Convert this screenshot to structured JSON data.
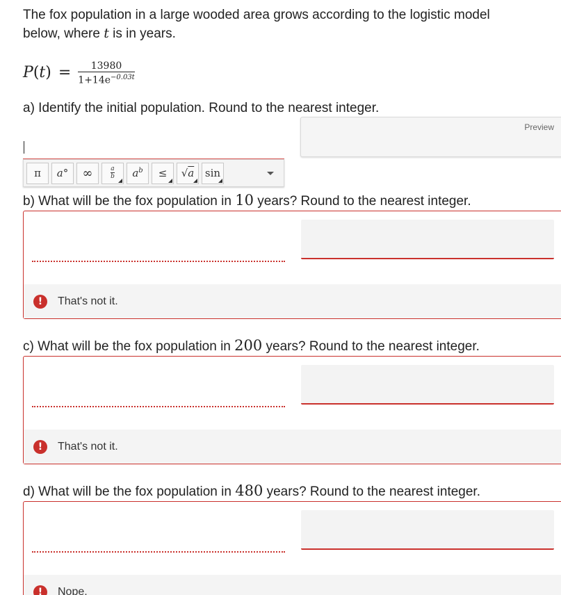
{
  "intro": {
    "line1": "The fox population in a large wooded area grows according to the logistic model",
    "line2_before": "below, where ",
    "line2_var": "t",
    "line2_after": " is in years."
  },
  "formula": {
    "lhs_func": "P",
    "lhs_open": "(",
    "lhs_var": "t",
    "lhs_close": ")",
    "equals": "=",
    "numerator": "13980",
    "denominator_base": "1+14e",
    "denominator_exponent": "−0.03t"
  },
  "part_a": {
    "question": "a) Identify the initial population. Round to the nearest integer.",
    "preview_label": "Preview",
    "input_value": ""
  },
  "toolbar": {
    "buttons": [
      {
        "icon": "pi-icon",
        "label": "π"
      },
      {
        "icon": "degree-icon",
        "label": "a°"
      },
      {
        "icon": "infinity-icon",
        "label": "∞"
      },
      {
        "icon": "fraction-icon",
        "label": "a/b"
      },
      {
        "icon": "power-icon",
        "label": "aᵇ"
      },
      {
        "icon": "less-equal-icon",
        "label": "≤"
      },
      {
        "icon": "sqrt-icon",
        "label": "√a"
      },
      {
        "icon": "trig-icon",
        "label": "sin"
      }
    ]
  },
  "part_b": {
    "prefix": "b) What will be the fox population in ",
    "years": "10",
    "suffix": " years? Round to the nearest integer.",
    "feedback": "That's not it."
  },
  "part_c": {
    "prefix": "c) What will be the fox population in ",
    "years": "200",
    "suffix": " years? Round to the nearest integer.",
    "feedback": "That's not it."
  },
  "part_d": {
    "prefix": "d) What will be the fox population in ",
    "years": "480",
    "suffix": " years? Round to the nearest integer.",
    "feedback": "Nope."
  },
  "colors": {
    "error": "#c9302c",
    "panel": "#f4f4f4"
  }
}
